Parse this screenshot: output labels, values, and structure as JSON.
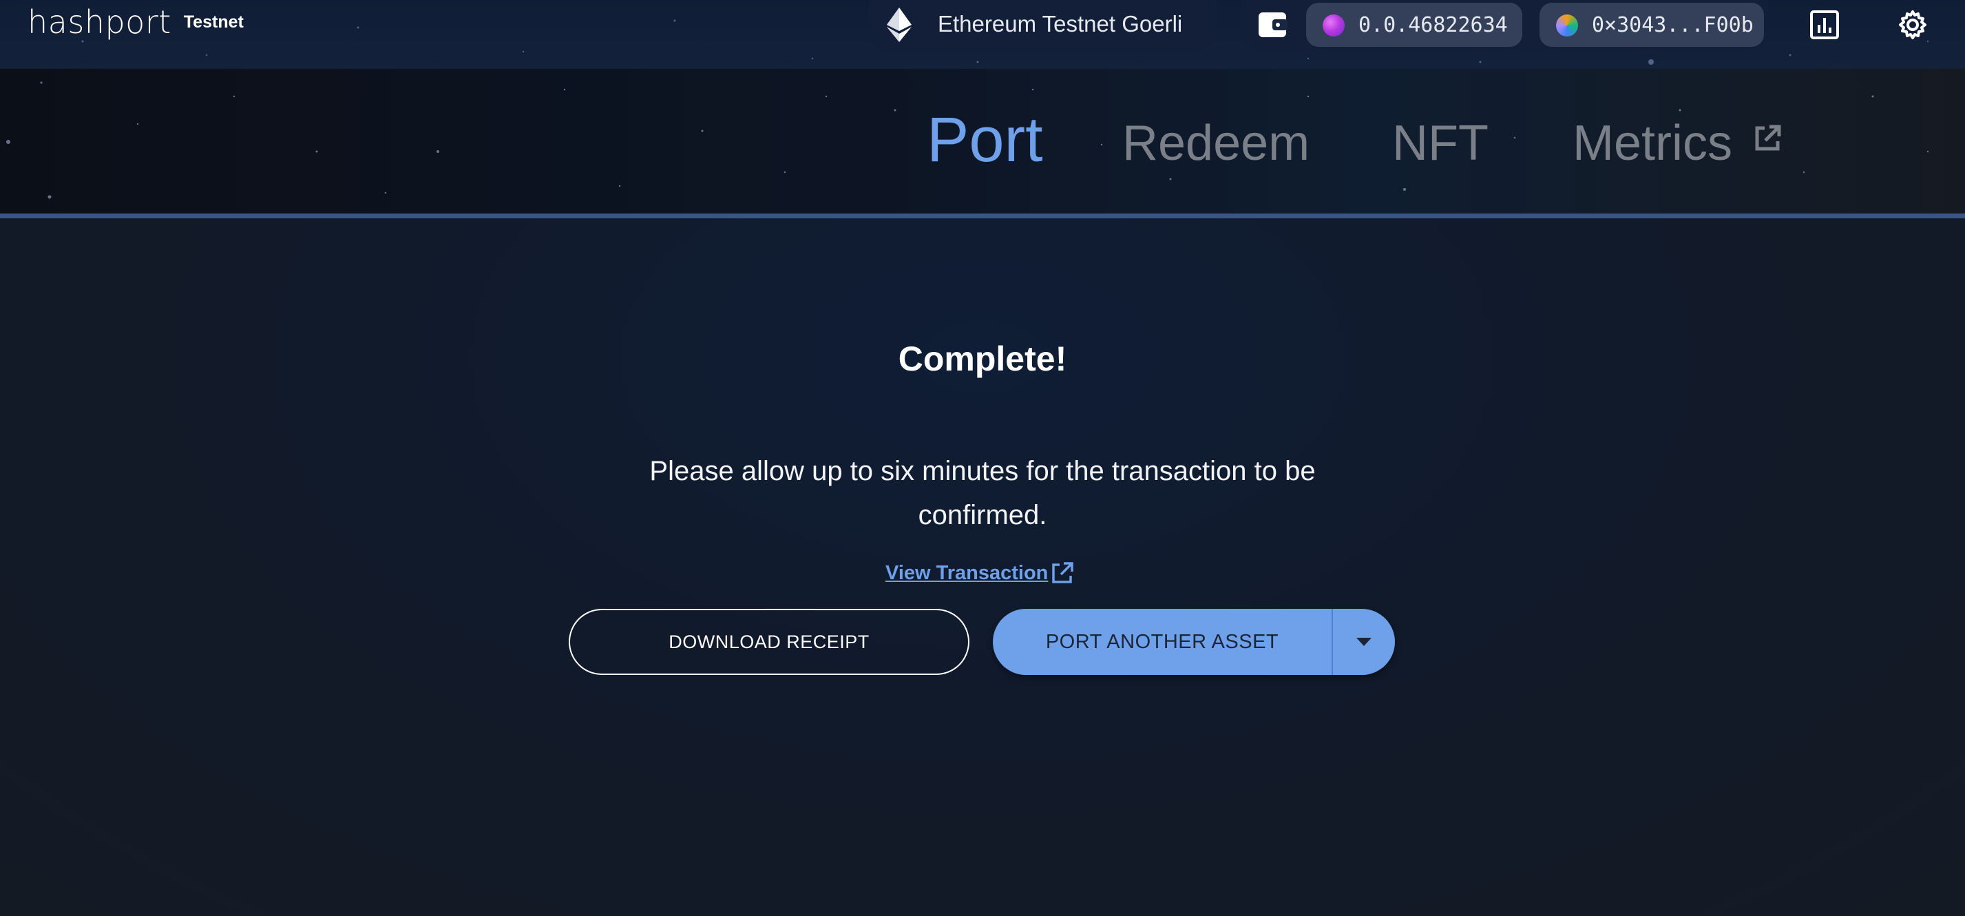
{
  "header": {
    "logo_text": "hashport",
    "logo_network_label": "Testnet",
    "network": {
      "label": "Ethereum Testnet Goerli",
      "icon": "ethereum-icon"
    },
    "wallet_icon": "wallet-icon",
    "hedera_account": {
      "label": "0.0.46822634",
      "icon": "hedera-avatar"
    },
    "evm_account": {
      "label": "0×3043...F00b",
      "icon": "evm-avatar"
    },
    "stats_icon": "bar-chart-icon",
    "settings_icon": "gear-icon"
  },
  "nav": {
    "items": [
      {
        "label": "Port",
        "active": true
      },
      {
        "label": "Redeem",
        "active": false
      },
      {
        "label": "NFT",
        "active": false
      },
      {
        "label": "Metrics",
        "active": false,
        "external": true
      }
    ]
  },
  "main": {
    "title": "Complete!",
    "message": "Please allow up to six minutes for the transaction to be confirmed.",
    "view_transaction": "View Transaction",
    "download_receipt": "DOWNLOAD RECEIPT",
    "port_another": "PORT ANOTHER ASSET"
  },
  "colors": {
    "accent": "#6fa0ea",
    "nav_inactive": "#7b7f88",
    "background": "#141a26",
    "pill": "#34405a"
  }
}
